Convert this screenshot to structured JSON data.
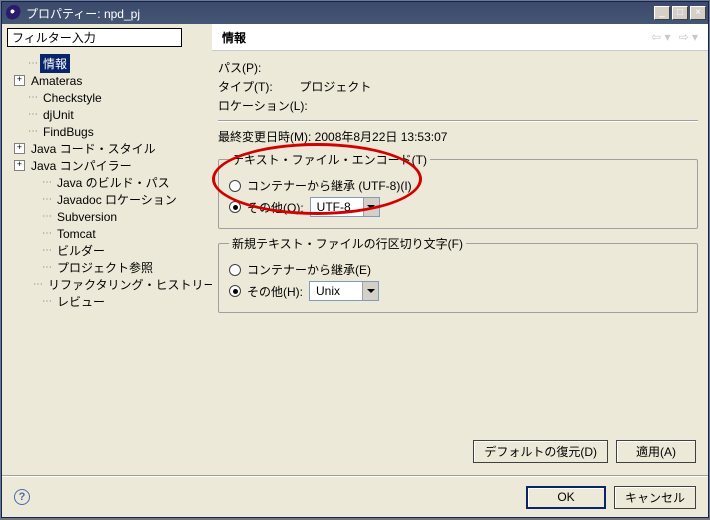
{
  "titlebar": {
    "title": "プロパティー: npd_pj"
  },
  "filter": {
    "placeholder": "フィルター入力"
  },
  "banner": {
    "title": "情報"
  },
  "tree": {
    "items": [
      {
        "label": "情報",
        "selected": true,
        "indent": false,
        "exp": "none"
      },
      {
        "label": "Amateras",
        "indent": false,
        "exp": "plus"
      },
      {
        "label": "Checkstyle",
        "indent": false,
        "exp": "none"
      },
      {
        "label": "djUnit",
        "indent": false,
        "exp": "none"
      },
      {
        "label": "FindBugs",
        "indent": false,
        "exp": "none"
      },
      {
        "label": "Java コード・スタイル",
        "indent": false,
        "exp": "plus"
      },
      {
        "label": "Java コンパイラー",
        "indent": false,
        "exp": "plus"
      },
      {
        "label": "Java のビルド・パス",
        "indent": true,
        "exp": "none"
      },
      {
        "label": "Javadoc ロケーション",
        "indent": true,
        "exp": "none"
      },
      {
        "label": "Subversion",
        "indent": true,
        "exp": "none"
      },
      {
        "label": "Tomcat",
        "indent": true,
        "exp": "none"
      },
      {
        "label": "ビルダー",
        "indent": true,
        "exp": "none"
      },
      {
        "label": "プロジェクト参照",
        "indent": true,
        "exp": "none"
      },
      {
        "label": "リファクタリング・ヒストリー",
        "indent": true,
        "exp": "none"
      },
      {
        "label": "レビュー",
        "indent": true,
        "exp": "none"
      }
    ]
  },
  "info": {
    "path_label": "パス(P):",
    "type_label": "タイプ(T):",
    "type_value": "プロジェクト",
    "location_label": "ロケーション(L):",
    "modified_label": "最終変更日時(M):",
    "modified_value": "2008年8月22日 13:53:07",
    "encoding": {
      "legend": "テキスト・ファイル・エンコード(T)",
      "inherit": "コンテナーから継承 (UTF-8)(I)",
      "other": "その他(O):",
      "other_value": "UTF-8"
    },
    "linebreak": {
      "legend": "新規テキスト・ファイルの行区切り文字(F)",
      "inherit": "コンテナーから継承(E)",
      "other": "その他(H):",
      "other_value": "Unix"
    },
    "restore_defaults": "デフォルトの復元(D)",
    "apply": "適用(A)"
  },
  "footer": {
    "ok": "OK",
    "cancel": "キャンセル"
  }
}
